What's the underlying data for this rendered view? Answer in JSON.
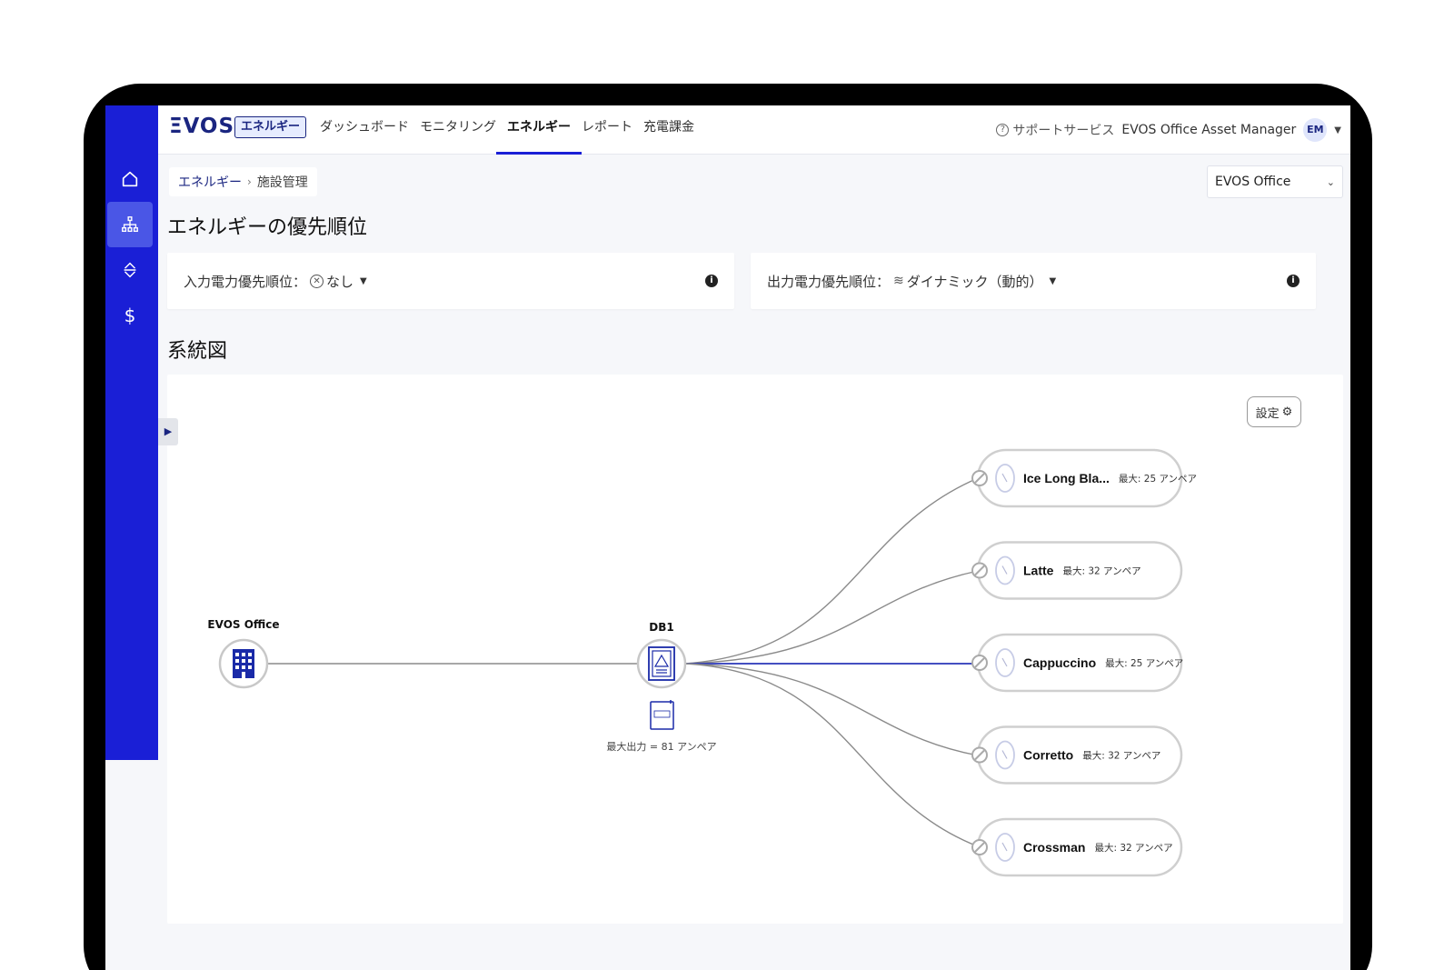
{
  "nav": {
    "logo": "ΞVOS",
    "module_badge": "エネルギー",
    "items": [
      {
        "label": "ダッシュボード"
      },
      {
        "label": "モニタリング"
      },
      {
        "label": "エネルギー"
      },
      {
        "label": "レポート"
      },
      {
        "label": "充電課金"
      }
    ],
    "active_item": "エネルギー",
    "support_label": "サポートサービス",
    "account_name": "EVOS Office Asset Manager",
    "avatar_initials": "EM"
  },
  "sidebar": {
    "items": [
      {
        "icon": "home-icon",
        "active": false
      },
      {
        "icon": "sitemap-icon",
        "active": true
      },
      {
        "icon": "sort-arrows-icon",
        "active": false
      },
      {
        "icon": "dollar-icon",
        "active": false,
        "glyph": "$"
      }
    ]
  },
  "breadcrumb": {
    "parent": "エネルギー",
    "current": "施設管理"
  },
  "site_selector": {
    "value": "EVOS Office"
  },
  "page_title": "エネルギーの優先順位",
  "input_priority": {
    "label": "入力電力優先順位：",
    "value": "なし"
  },
  "output_priority": {
    "label": "出力電力優先順位：",
    "value": "ダイナミック（動的）"
  },
  "diagram_title": "系統図",
  "diagram": {
    "settings_label": "設定",
    "site_node": {
      "name": "EVOS Office"
    },
    "db_node": {
      "name": "DB1",
      "max_output": "最大出力 = 81 アンペア"
    },
    "chargers": [
      {
        "name": "Ice Long Bla...",
        "max": "最大: 25 アンペア",
        "connected": false
      },
      {
        "name": "Latte",
        "max": "最大: 32 アンペア",
        "connected": false
      },
      {
        "name": "Cappuccino",
        "max": "最大: 25 アンペア",
        "connected": true
      },
      {
        "name": "Corretto",
        "max": "最大: 32 アンペア",
        "connected": false
      },
      {
        "name": "Crossman",
        "max": "最大: 32 アンペア",
        "connected": false
      }
    ]
  },
  "colors": {
    "sidebar": "#1a1fd6",
    "brand": "#1a2580",
    "active_line": "#2a36b8",
    "line": "#8a8a8a"
  }
}
